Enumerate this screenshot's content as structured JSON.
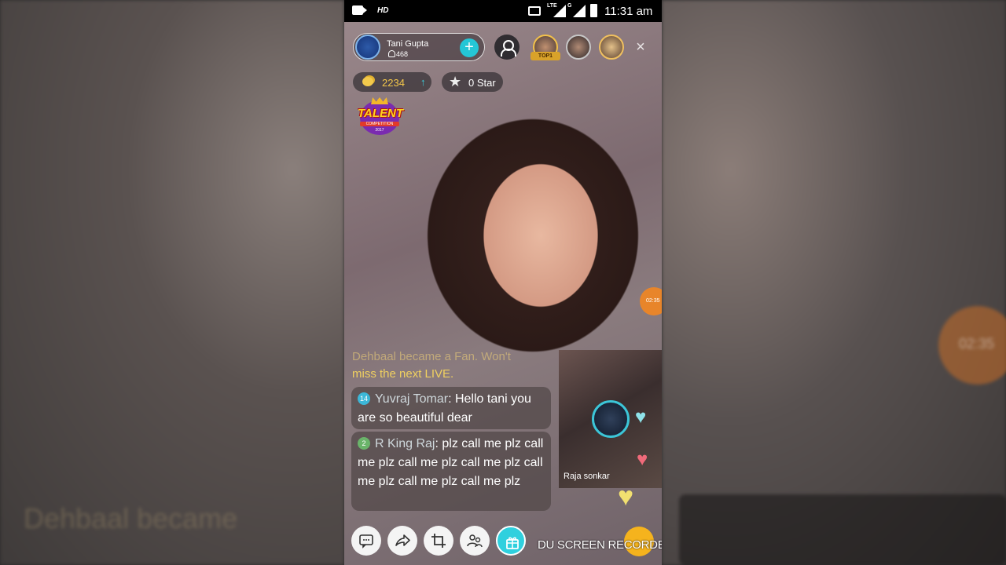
{
  "status_bar": {
    "quality": "HD",
    "lte": "LTE",
    "network_g": "G",
    "time": "11:31 am"
  },
  "host": {
    "name": "Tani Gupta",
    "followers": "468"
  },
  "top_viewer_badge": "TOP1",
  "stats": {
    "coins": "2234",
    "stars": "0 Star"
  },
  "talent_badge": {
    "title": "TALENT",
    "subtitle": "COMPETITION",
    "year": "2017"
  },
  "timer": "02:35",
  "chat": {
    "faded_line": "Dehbaal became a Fan. Won't",
    "system_line": "miss the next LIVE.",
    "messages": [
      {
        "level": "14",
        "user": "Yuvraj Tomar",
        "text": ": Hello tani you are so beautiful dear"
      },
      {
        "level": "2",
        "user": "R King Raj",
        "text": ": plz call me plz call me plz call me plz call me plz call me plz call me plz call me plz"
      }
    ]
  },
  "pip": {
    "name": "Raja sonkar"
  },
  "recorder_watermark": "DU SCREEN RECORDER",
  "side_ghost": {
    "left_text": "Dehbaal became",
    "right_timer": "02:35"
  },
  "colors": {
    "accent": "#24c6d6",
    "coin": "#f5c84a",
    "system_chat": "#f0d060",
    "timer": "#e8852a"
  },
  "icons": [
    "camera-icon",
    "cast-icon",
    "signal-icon",
    "battery-icon",
    "plus-icon",
    "profile-icon",
    "close-icon",
    "coin-icon",
    "arrow-up-icon",
    "star-icon",
    "chat-icon",
    "share-icon",
    "crop-icon",
    "guest-icon",
    "gift-icon",
    "heart-icon"
  ]
}
